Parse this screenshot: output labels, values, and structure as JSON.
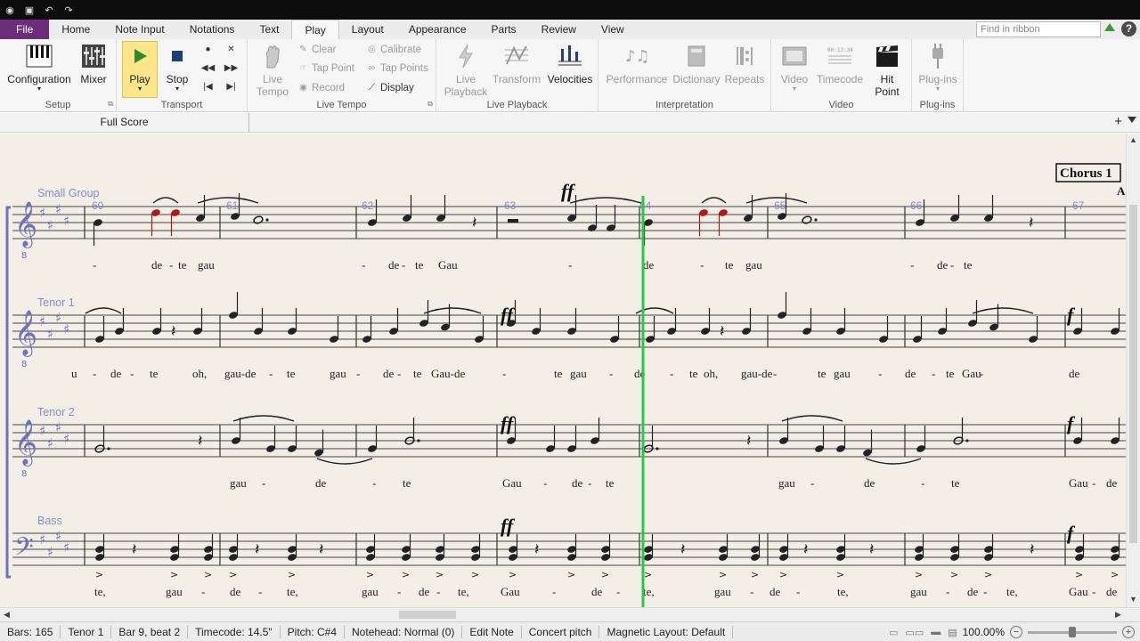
{
  "window": {
    "quick_access": [
      "app-icon",
      "save-icon",
      "undo-icon",
      "redo-icon"
    ]
  },
  "ribbon_tabs": [
    "File",
    "Home",
    "Note Input",
    "Notations",
    "Text",
    "Play",
    "Layout",
    "Appearance",
    "Parts",
    "Review",
    "View"
  ],
  "active_tab": "Play",
  "search": {
    "placeholder": "Find in ribbon"
  },
  "help_label": "?",
  "groups": {
    "setup": {
      "label": "Setup",
      "configuration": "Configuration",
      "mixer": "Mixer"
    },
    "transport": {
      "label": "Transport",
      "play": "Play",
      "stop": "Stop"
    },
    "live_tempo": {
      "label": "Live Tempo",
      "live_tempo": "Live Tempo",
      "clear": "Clear",
      "tap_point": "Tap Point",
      "record": "Record",
      "calibrate": "Calibrate",
      "tap_points": "Tap Points",
      "display": "Display"
    },
    "live_playback": {
      "label": "Live Playback",
      "live_playback": "Live Playback",
      "transform": "Transform",
      "velocities": "Velocities"
    },
    "interpretation": {
      "label": "Interpretation",
      "performance": "Performance",
      "dictionary": "Dictionary",
      "repeats": "Repeats"
    },
    "video": {
      "label": "Video",
      "video": "Video",
      "timecode": "Timecode",
      "hit_point": "Hit Point"
    },
    "plugins": {
      "label": "Plug-ins",
      "plugins": "Plug-ins"
    }
  },
  "document_tab": "Full Score",
  "score": {
    "rehearsal_mark": "Chorus 1",
    "rehearsal_next": "A",
    "bar_numbers": [
      "60",
      "61",
      "62",
      "63",
      "64",
      "65",
      "66",
      "67"
    ],
    "staves": [
      {
        "name": "Small Group",
        "lyrics": [
          "-",
          "de",
          "-",
          "te",
          "gau",
          "-",
          "de",
          "-",
          "te",
          "Gau",
          "-",
          "de",
          "-",
          "te",
          "gau",
          "-",
          "de",
          "-",
          "te"
        ]
      },
      {
        "name": "Tenor 1",
        "lyrics": [
          "u",
          "-",
          "de",
          "-",
          "te",
          "oh,",
          "gau-de",
          "-",
          "te",
          "gau",
          "-",
          "de",
          "-",
          "te",
          "Gau-de",
          "-",
          "te",
          "gau",
          "-",
          "de",
          "-",
          "te",
          "oh,",
          "gau-de",
          "-",
          "te",
          "gau",
          "-",
          "de",
          "-",
          "te",
          "Gau",
          "-",
          "de"
        ]
      },
      {
        "name": "Tenor 2",
        "lyrics": [
          "gau",
          "-",
          "de",
          "-",
          "te",
          "Gau",
          "-",
          "de",
          "-",
          "te",
          "gau",
          "-",
          "de",
          "-",
          "te",
          "Gau",
          "-",
          "de"
        ]
      },
      {
        "name": "Bass",
        "lyrics": [
          "te,",
          "gau",
          "-",
          "de",
          "-",
          "te,",
          "gau",
          "-",
          "de",
          "-",
          "te,",
          "Gau",
          "-",
          "de",
          "-",
          "te,",
          "gau",
          "-",
          "de",
          "-",
          "te,",
          "gau",
          "-",
          "de",
          "-",
          "te,",
          "Gau",
          "-",
          "de"
        ]
      }
    ],
    "dynamics": {
      "ff": "ff",
      "f": "f"
    }
  },
  "status": {
    "bars": "Bars: 165",
    "instrument": "Tenor 1",
    "position": "Bar 9, beat 2",
    "timecode": "Timecode: 14.5\"",
    "pitch": "Pitch: C#4",
    "notehead": "Notehead: Normal (0)",
    "mode": "Edit Note",
    "pitch_mode": "Concert pitch",
    "magnetic": "Magnetic Layout: Default",
    "zoom": "100.00%",
    "zoom_level": 0.5
  },
  "colors": {
    "file_tab": "#6c2e7a",
    "play_highlight": "#fde68a",
    "playback_line": "#22cc44",
    "staff_label": "#8a8ac8",
    "selected_note": "#b01818"
  }
}
